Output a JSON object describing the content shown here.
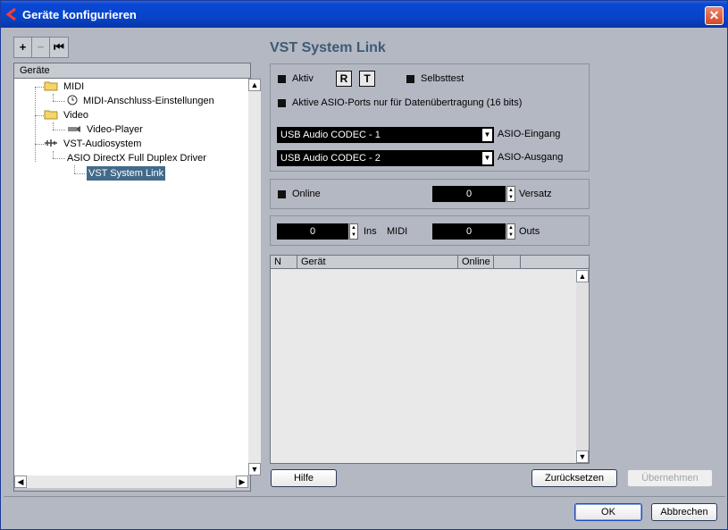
{
  "window": {
    "title": "Geräte konfigurieren",
    "close_glyph": "✕"
  },
  "toolbar": {
    "add": "+",
    "remove": "−",
    "reset": "⏮"
  },
  "tree": {
    "header": "Geräte",
    "items": [
      {
        "label": "MIDI",
        "icon": "folder-icon"
      },
      {
        "label": "MIDI-Anschluss-Einstellungen",
        "icon": "clock-icon"
      },
      {
        "label": "Video",
        "icon": "folder-icon"
      },
      {
        "label": "Video-Player",
        "icon": "video-icon"
      },
      {
        "label": "VST-Audiosystem",
        "icon": "audio-icon"
      },
      {
        "label": "ASIO DirectX Full Duplex Driver",
        "icon": ""
      },
      {
        "label": "VST System Link",
        "icon": ""
      }
    ]
  },
  "panel": {
    "title": "VST System Link",
    "aktiv_label": "Aktiv",
    "r_button": "R",
    "t_button": "T",
    "selbsttest_label": "Selbsttest",
    "asio_ports_label": "Aktive ASIO-Ports nur für Datenübertragung (16 bits)",
    "input_combo": "USB Audio CODEC  - 1",
    "input_label": "ASIO-Eingang",
    "output_combo": "USB Audio CODEC  - 2",
    "output_label": "ASIO-Ausgang",
    "online_label": "Online",
    "versatz_value": "0",
    "versatz_label": "Versatz",
    "ins_value": "0",
    "ins_label": "Ins",
    "midi_label": "MIDI",
    "outs_value": "0",
    "outs_label": "Outs"
  },
  "table": {
    "columns": [
      "N",
      "Gerät",
      "Online",
      "",
      ""
    ]
  },
  "buttons": {
    "hilfe": "Hilfe",
    "zuruecksetzen": "Zurücksetzen",
    "uebernehmen": "Übernehmen",
    "ok": "OK",
    "abbrechen": "Abbrechen"
  },
  "colors": {
    "selection": "#426a8a",
    "title_bar": "#0a47d6",
    "heading": "#3e5b74"
  }
}
